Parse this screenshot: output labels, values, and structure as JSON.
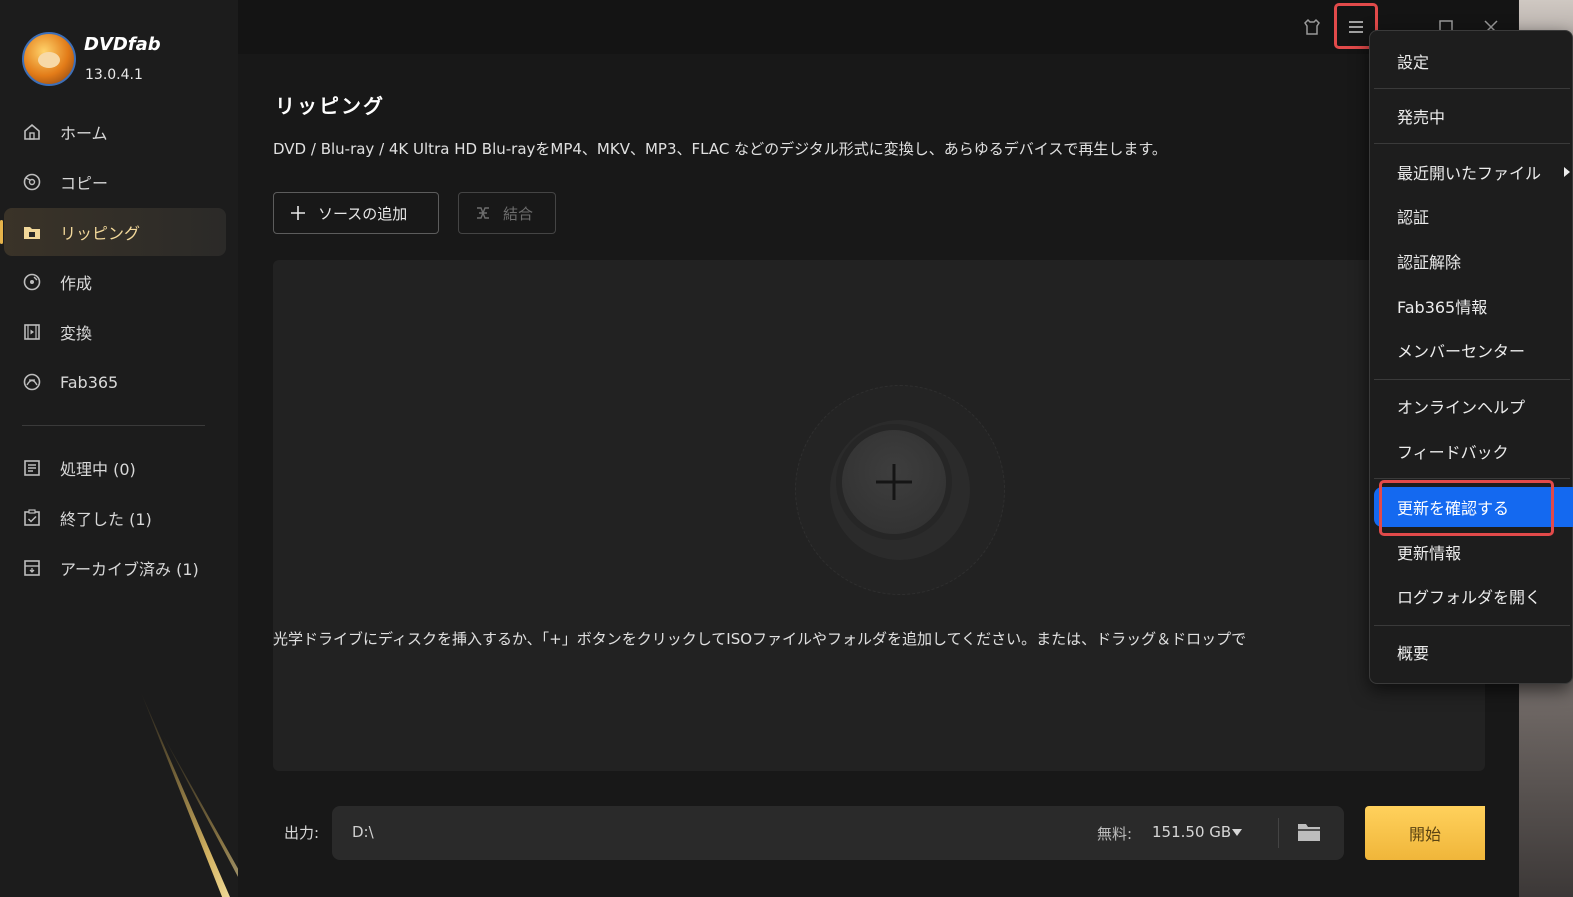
{
  "app": {
    "brand": "DVDfab",
    "version": "13.0.4.1"
  },
  "sidebar": {
    "items": [
      {
        "label": "ホーム",
        "icon": "home-icon"
      },
      {
        "label": "コピー",
        "icon": "disc-copy-icon"
      },
      {
        "label": "リッピング",
        "icon": "ripper-folder-icon",
        "active": true
      },
      {
        "label": "作成",
        "icon": "creator-disc-icon"
      },
      {
        "label": "変換",
        "icon": "film-convert-icon"
      },
      {
        "label": "Fab365",
        "icon": "fab365-icon"
      }
    ],
    "queue": [
      {
        "label": "処理中 (0)",
        "icon": "task-list-icon"
      },
      {
        "label": "終了した (1)",
        "icon": "checklist-icon"
      },
      {
        "label": "アーカイブ済み (1)",
        "icon": "archive-box-icon"
      }
    ]
  },
  "page": {
    "title": "リッピング",
    "description": "DVD / Blu-ray / 4K Ultra HD Blu-rayをMP4、MKV、MP3、FLAC などのデジタル形式に変換し、あらゆるデバイスで再生します。",
    "add_source_label": "ソースの追加",
    "merge_label": "結合",
    "drop_hint": "光学ドライブにディスクを挿入するか、「+」ボタンをクリックしてISOファイルやフォルダを追加してください。または、ドラッグ＆ドロップで"
  },
  "output": {
    "label": "出力:",
    "path": "D:\\",
    "free_label": "無料:",
    "free_space": "151.50 GB",
    "start_label": "開始"
  },
  "menu": {
    "items": [
      {
        "label": "設定"
      },
      {
        "label": "発売中"
      },
      {
        "label": "最近開いたファイル",
        "submenu": true
      },
      {
        "label": "認証"
      },
      {
        "label": "認証解除"
      },
      {
        "label": "Fab365情報"
      },
      {
        "label": "メンバーセンター"
      },
      {
        "label": "オンラインヘルプ"
      },
      {
        "label": "フィードバック"
      },
      {
        "label": "更新を確認する",
        "selected": true
      },
      {
        "label": "更新情報"
      },
      {
        "label": "ログフォルダを開く"
      },
      {
        "label": "概要"
      }
    ]
  },
  "colors": {
    "accent_gold": "#e6b34a",
    "start_button": "#f5c24a",
    "menu_selected": "#1469f0",
    "highlight_box": "#e24a4a"
  }
}
